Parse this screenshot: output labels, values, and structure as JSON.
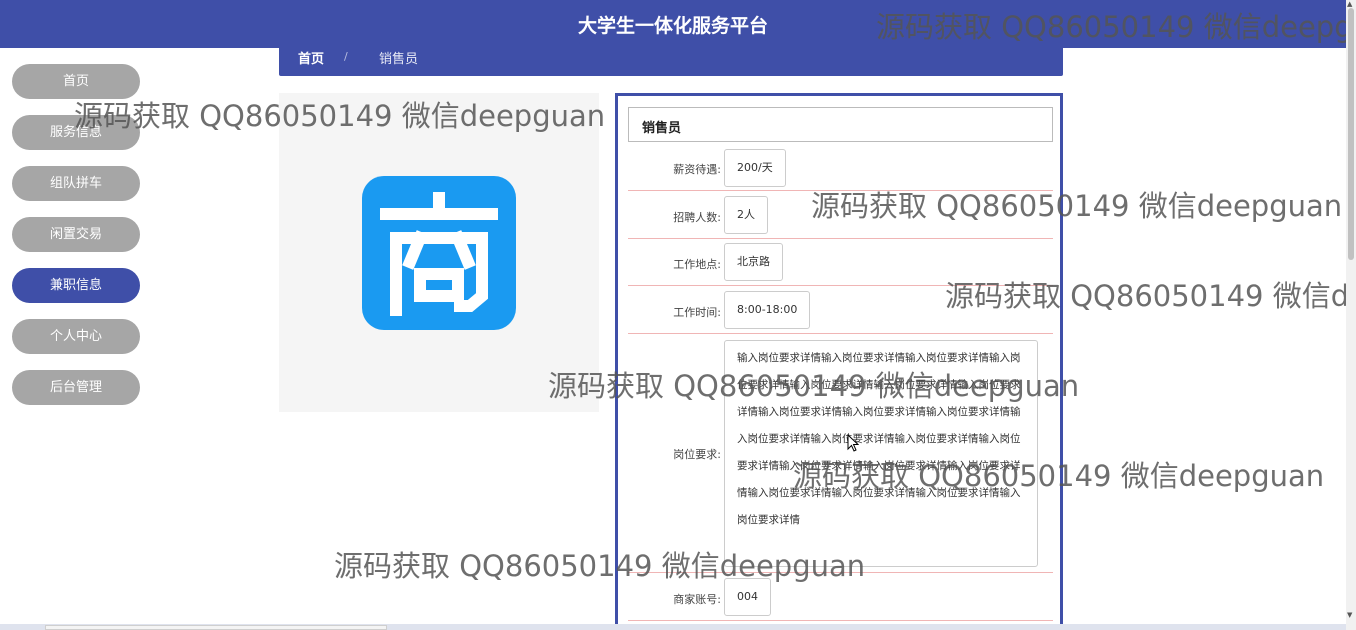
{
  "header": {
    "title": "大学生一体化服务平台"
  },
  "breadcrumb": {
    "home": "首页",
    "separator": "/",
    "current": "销售员"
  },
  "sidebar": {
    "items": [
      {
        "label": "首页",
        "active": false
      },
      {
        "label": "服务信息",
        "active": false
      },
      {
        "label": "组队拼车",
        "active": false
      },
      {
        "label": "闲置交易",
        "active": false
      },
      {
        "label": "兼职信息",
        "active": true
      },
      {
        "label": "个人中心",
        "active": false
      },
      {
        "label": "后台管理",
        "active": false
      }
    ]
  },
  "image": {
    "logo_char": "商",
    "logo_color": "#1a9af1"
  },
  "detail": {
    "title": "销售员",
    "fields": {
      "salary": {
        "label": "薪资待遇:",
        "value": "200/天"
      },
      "headcount": {
        "label": "招聘人数:",
        "value": "2人"
      },
      "location": {
        "label": "工作地点:",
        "value": "北京路"
      },
      "hours": {
        "label": "工作时间:",
        "value": "8:00-18:00"
      },
      "requirements": {
        "label": "岗位要求:",
        "value": "输入岗位要求详情输入岗位要求详情输入岗位要求详情输入岗位要求详情输入岗位要求详情输入岗位要求详情输入岗位要求详情输入岗位要求详情输入岗位要求详情输入岗位要求详情输入岗位要求详情输入岗位要求详情输入岗位要求详情输入岗位要求详情输入岗位要求详情输入岗位要求详情输入岗位要求详情输入岗位要求详情输入岗位要求详情输入岗位要求详情输入岗位要求详情"
      },
      "merchant": {
        "label": "商家账号:",
        "value": "004"
      }
    }
  },
  "watermark": {
    "text": "源码获取 QQ86050149 微信deepguan"
  },
  "colors": {
    "primary": "#3f4fa8",
    "sidebar_inactive": "#a6a6a6",
    "row_divider": "#f0b5b5"
  }
}
